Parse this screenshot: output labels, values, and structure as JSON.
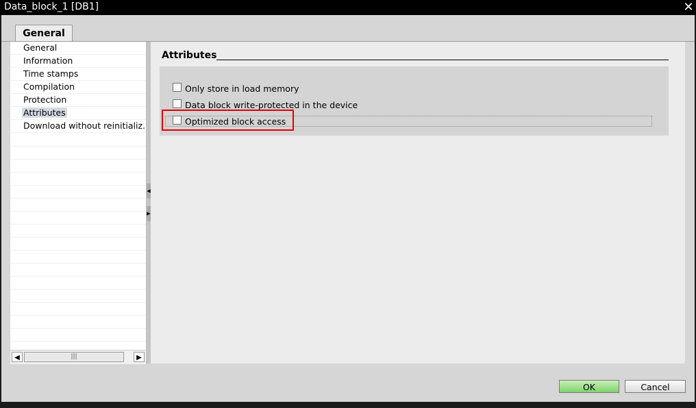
{
  "window": {
    "title": "Data_block_1 [DB1]",
    "close_icon": "close-icon"
  },
  "tabs": [
    {
      "label": "General",
      "active": true
    }
  ],
  "nav": {
    "items": [
      {
        "label": "General",
        "selected": false
      },
      {
        "label": "Information",
        "selected": false
      },
      {
        "label": "Time stamps",
        "selected": false
      },
      {
        "label": "Compilation",
        "selected": false
      },
      {
        "label": "Protection",
        "selected": false
      },
      {
        "label": "Attributes",
        "selected": true
      },
      {
        "label": "Download without reinitializ...",
        "selected": false
      }
    ]
  },
  "content": {
    "heading": "Attributes",
    "options": [
      {
        "label": "Only store in load memory",
        "checked": false
      },
      {
        "label": "Data block write-protected in the device",
        "checked": false
      },
      {
        "label": "Optimized block access",
        "checked": false
      }
    ]
  },
  "buttons": {
    "ok": "OK",
    "cancel": "Cancel"
  },
  "colors": {
    "highlight": "#e00000",
    "ok_button": "#8fd97a",
    "selected_nav": "#d4dbe3"
  }
}
